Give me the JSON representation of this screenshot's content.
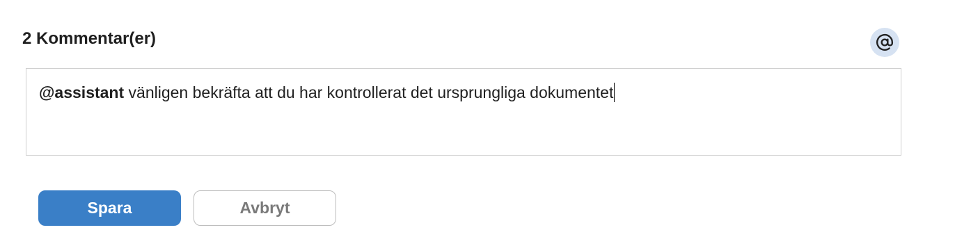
{
  "comments": {
    "title": "2 Kommentar(er)",
    "mention_icon": "at-sign-icon"
  },
  "editor": {
    "mention": "@assistant",
    "text": " vänligen bekräfta att du har kontrollerat det ursprungliga dokumentet"
  },
  "actions": {
    "save_label": "Spara",
    "cancel_label": "Avbryt"
  },
  "colors": {
    "primary": "#3a7fc7",
    "mention_button_bg": "#d6e2f2",
    "border": "#cfcfcf"
  }
}
